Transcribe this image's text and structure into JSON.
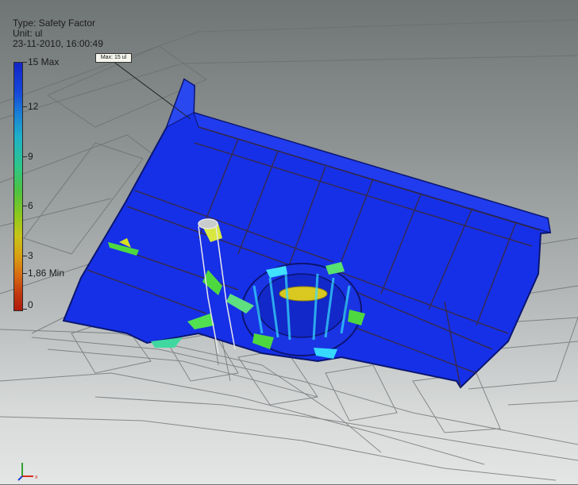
{
  "header": {
    "type_label": "Type: Safety Factor",
    "unit_label": "Unit: ul",
    "timestamp": "23-11-2010, 16:00:49"
  },
  "legend": {
    "ticks": [
      {
        "label": "15 Max",
        "value": 15
      },
      {
        "label": "12",
        "value": 12
      },
      {
        "label": "9",
        "value": 9
      },
      {
        "label": "6",
        "value": 6
      },
      {
        "label": "3",
        "value": 3
      },
      {
        "label": "1,86 Min",
        "value": 1.86
      },
      {
        "label": "0",
        "value": 0
      }
    ],
    "range": [
      0,
      15
    ],
    "colors": {
      "high": "#1224c8",
      "mid": "#4ec23e",
      "low": "#b01a0c"
    }
  },
  "max_callout": "Max: 15 ul",
  "triad": {
    "icon": "xyz-axis-triad-icon",
    "x_color": "#d83020",
    "y_color": "#30a030",
    "z_color": "#2040d0"
  },
  "colors": {
    "part_blue": "#1630e8",
    "hot_green": "#4ed840",
    "hot_yellow": "#d8c820",
    "background_top": "#6f7475",
    "background_bottom": "#e4e6e6"
  }
}
